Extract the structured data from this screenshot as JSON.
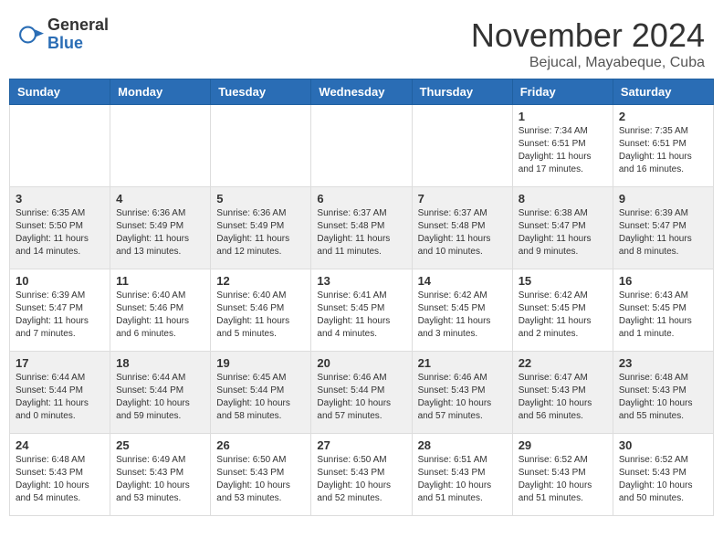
{
  "header": {
    "logo_general": "General",
    "logo_blue": "Blue",
    "month_title": "November 2024",
    "subtitle": "Bejucal, Mayabeque, Cuba"
  },
  "weekdays": [
    "Sunday",
    "Monday",
    "Tuesday",
    "Wednesday",
    "Thursday",
    "Friday",
    "Saturday"
  ],
  "weeks": [
    [
      {
        "day": "",
        "info": ""
      },
      {
        "day": "",
        "info": ""
      },
      {
        "day": "",
        "info": ""
      },
      {
        "day": "",
        "info": ""
      },
      {
        "day": "",
        "info": ""
      },
      {
        "day": "1",
        "info": "Sunrise: 7:34 AM\nSunset: 6:51 PM\nDaylight: 11 hours and 17 minutes."
      },
      {
        "day": "2",
        "info": "Sunrise: 7:35 AM\nSunset: 6:51 PM\nDaylight: 11 hours and 16 minutes."
      }
    ],
    [
      {
        "day": "3",
        "info": "Sunrise: 6:35 AM\nSunset: 5:50 PM\nDaylight: 11 hours and 14 minutes."
      },
      {
        "day": "4",
        "info": "Sunrise: 6:36 AM\nSunset: 5:49 PM\nDaylight: 11 hours and 13 minutes."
      },
      {
        "day": "5",
        "info": "Sunrise: 6:36 AM\nSunset: 5:49 PM\nDaylight: 11 hours and 12 minutes."
      },
      {
        "day": "6",
        "info": "Sunrise: 6:37 AM\nSunset: 5:48 PM\nDaylight: 11 hours and 11 minutes."
      },
      {
        "day": "7",
        "info": "Sunrise: 6:37 AM\nSunset: 5:48 PM\nDaylight: 11 hours and 10 minutes."
      },
      {
        "day": "8",
        "info": "Sunrise: 6:38 AM\nSunset: 5:47 PM\nDaylight: 11 hours and 9 minutes."
      },
      {
        "day": "9",
        "info": "Sunrise: 6:39 AM\nSunset: 5:47 PM\nDaylight: 11 hours and 8 minutes."
      }
    ],
    [
      {
        "day": "10",
        "info": "Sunrise: 6:39 AM\nSunset: 5:47 PM\nDaylight: 11 hours and 7 minutes."
      },
      {
        "day": "11",
        "info": "Sunrise: 6:40 AM\nSunset: 5:46 PM\nDaylight: 11 hours and 6 minutes."
      },
      {
        "day": "12",
        "info": "Sunrise: 6:40 AM\nSunset: 5:46 PM\nDaylight: 11 hours and 5 minutes."
      },
      {
        "day": "13",
        "info": "Sunrise: 6:41 AM\nSunset: 5:45 PM\nDaylight: 11 hours and 4 minutes."
      },
      {
        "day": "14",
        "info": "Sunrise: 6:42 AM\nSunset: 5:45 PM\nDaylight: 11 hours and 3 minutes."
      },
      {
        "day": "15",
        "info": "Sunrise: 6:42 AM\nSunset: 5:45 PM\nDaylight: 11 hours and 2 minutes."
      },
      {
        "day": "16",
        "info": "Sunrise: 6:43 AM\nSunset: 5:45 PM\nDaylight: 11 hours and 1 minute."
      }
    ],
    [
      {
        "day": "17",
        "info": "Sunrise: 6:44 AM\nSunset: 5:44 PM\nDaylight: 11 hours and 0 minutes."
      },
      {
        "day": "18",
        "info": "Sunrise: 6:44 AM\nSunset: 5:44 PM\nDaylight: 10 hours and 59 minutes."
      },
      {
        "day": "19",
        "info": "Sunrise: 6:45 AM\nSunset: 5:44 PM\nDaylight: 10 hours and 58 minutes."
      },
      {
        "day": "20",
        "info": "Sunrise: 6:46 AM\nSunset: 5:44 PM\nDaylight: 10 hours and 57 minutes."
      },
      {
        "day": "21",
        "info": "Sunrise: 6:46 AM\nSunset: 5:43 PM\nDaylight: 10 hours and 57 minutes."
      },
      {
        "day": "22",
        "info": "Sunrise: 6:47 AM\nSunset: 5:43 PM\nDaylight: 10 hours and 56 minutes."
      },
      {
        "day": "23",
        "info": "Sunrise: 6:48 AM\nSunset: 5:43 PM\nDaylight: 10 hours and 55 minutes."
      }
    ],
    [
      {
        "day": "24",
        "info": "Sunrise: 6:48 AM\nSunset: 5:43 PM\nDaylight: 10 hours and 54 minutes."
      },
      {
        "day": "25",
        "info": "Sunrise: 6:49 AM\nSunset: 5:43 PM\nDaylight: 10 hours and 53 minutes."
      },
      {
        "day": "26",
        "info": "Sunrise: 6:50 AM\nSunset: 5:43 PM\nDaylight: 10 hours and 53 minutes."
      },
      {
        "day": "27",
        "info": "Sunrise: 6:50 AM\nSunset: 5:43 PM\nDaylight: 10 hours and 52 minutes."
      },
      {
        "day": "28",
        "info": "Sunrise: 6:51 AM\nSunset: 5:43 PM\nDaylight: 10 hours and 51 minutes."
      },
      {
        "day": "29",
        "info": "Sunrise: 6:52 AM\nSunset: 5:43 PM\nDaylight: 10 hours and 51 minutes."
      },
      {
        "day": "30",
        "info": "Sunrise: 6:52 AM\nSunset: 5:43 PM\nDaylight: 10 hours and 50 minutes."
      }
    ]
  ]
}
